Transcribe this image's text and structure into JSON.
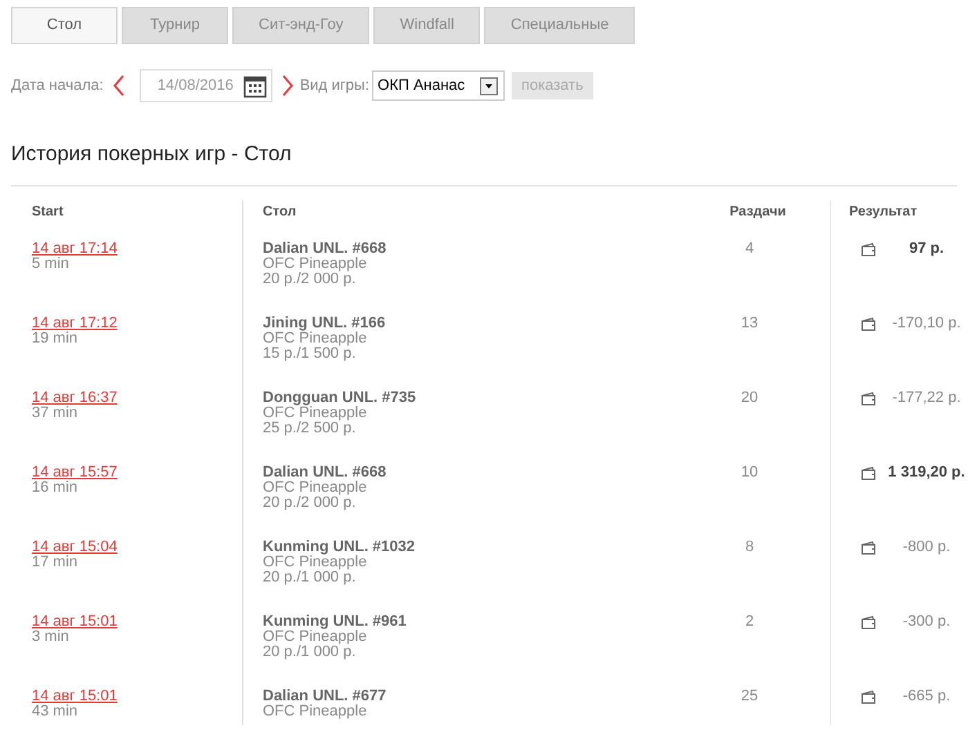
{
  "tabs": [
    {
      "label": "Стол",
      "selected": true
    },
    {
      "label": "Турнир",
      "selected": false
    },
    {
      "label": "Сит-энд-Гоу",
      "selected": false
    },
    {
      "label": "Windfall",
      "selected": false
    },
    {
      "label": "Специальные",
      "selected": false
    }
  ],
  "filters": {
    "date_label": "Дата начала:",
    "date_value": "14/08/2016",
    "game_label": "Вид игры:",
    "game_value": "ОКП Ананас",
    "show_button": "показать"
  },
  "heading": "История покерных игр - Стол",
  "table": {
    "columns": [
      "Start",
      "Стол",
      "Раздачи",
      "Результат"
    ],
    "rows": [
      {
        "start": "14 авг 17:14",
        "duration": "5 min",
        "table": "Dalian UNL. #668",
        "game": "OFC Pineapple",
        "stakes": "20 р./2 000 р.",
        "hands": "4",
        "result": "97 р.",
        "emphasis": true
      },
      {
        "start": "14 авг 17:12",
        "duration": "19 min",
        "table": "Jining UNL. #166",
        "game": "OFC Pineapple",
        "stakes": "15 р./1 500 р.",
        "hands": "13",
        "result": "-170,10 р.",
        "emphasis": false
      },
      {
        "start": "14 авг 16:37",
        "duration": "37 min",
        "table": "Dongguan UNL. #735",
        "game": "OFC Pineapple",
        "stakes": "25 р./2 500 р.",
        "hands": "20",
        "result": "-177,22 р.",
        "emphasis": false
      },
      {
        "start": "14 авг 15:57",
        "duration": "16 min",
        "table": "Dalian UNL. #668",
        "game": "OFC Pineapple",
        "stakes": "20 р./2 000 р.",
        "hands": "10",
        "result": "1 319,20 р.",
        "emphasis": true
      },
      {
        "start": "14 авг 15:04",
        "duration": "17 min",
        "table": "Kunming UNL. #1032",
        "game": "OFC Pineapple",
        "stakes": "20 р./1 000 р.",
        "hands": "8",
        "result": "-800 р.",
        "emphasis": false
      },
      {
        "start": "14 авг 15:01",
        "duration": "3 min",
        "table": "Kunming UNL. #961",
        "game": "OFC Pineapple",
        "stakes": "20 р./1 000 р.",
        "hands": "2",
        "result": "-300 р.",
        "emphasis": false
      },
      {
        "start": "14 авг 15:01",
        "duration": "43 min",
        "table": "Dalian UNL. #677",
        "game": "OFC Pineapple",
        "hands": "25",
        "result": "-665 р.",
        "emphasis": false
      }
    ]
  }
}
